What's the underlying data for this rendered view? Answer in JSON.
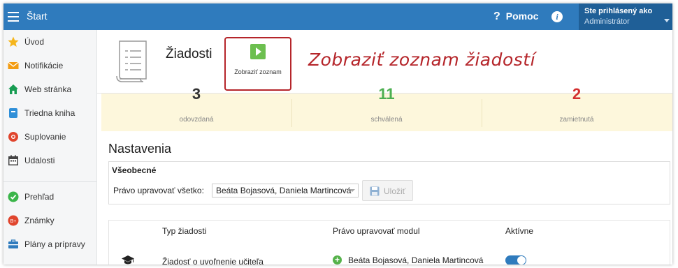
{
  "topbar": {
    "menu_icon": "hamburger-icon",
    "title": "Štart",
    "help_label": "Pomoc",
    "help_icon": "question-icon",
    "info_icon": "info-icon",
    "user_line1": "Ste prihlásený ako",
    "user_line2": "Administrátor"
  },
  "sidebar": {
    "items": [
      {
        "label": "Úvod",
        "icon": "star-icon"
      },
      {
        "label": "Notifikácie",
        "icon": "envelope-icon"
      },
      {
        "label": "Web stránka",
        "icon": "home-icon"
      },
      {
        "label": "Triedna kniha",
        "icon": "book-icon"
      },
      {
        "label": "Suplovanie",
        "icon": "life-ring-icon"
      },
      {
        "label": "Udalosti",
        "icon": "calendar-icon"
      },
      {
        "label": "Prehľad",
        "icon": "check-circle-icon"
      },
      {
        "label": "Známky",
        "icon": "grades-icon"
      },
      {
        "label": "Plány a prípravy",
        "icon": "briefcase-icon"
      }
    ]
  },
  "header": {
    "title": "Žiadosti",
    "action_label": "Zobraziť zoznam",
    "annotation": "Zobraziť zoznam žiadostí"
  },
  "stats": [
    {
      "value": "3",
      "label": "odovzdaná",
      "color": "#333333"
    },
    {
      "value": "11",
      "label": "schválená",
      "color": "#4caf50"
    },
    {
      "value": "2",
      "label": "zamietnutá",
      "color": "#d32f2f"
    }
  ],
  "settings": {
    "title": "Nastavenia",
    "general_title": "Všeobecné",
    "perm_label": "Právo upravovať všetko:",
    "perm_value": "Beáta Bojasová, Daniela Martincová",
    "save_label": "Uložiť"
  },
  "table": {
    "headers": [
      "Typ žiadosti",
      "Právo upravovať modul",
      "Aktívne"
    ],
    "rows": [
      {
        "type": "Žiadosť o uvoľnenie učiteľa",
        "editors": "Beáta Bojasová, Daniela Martincová",
        "active": true
      }
    ]
  },
  "colors": {
    "primary": "#2f7bbd",
    "accent_red": "#b5252a",
    "stats_bg": "#fdf7dc"
  }
}
